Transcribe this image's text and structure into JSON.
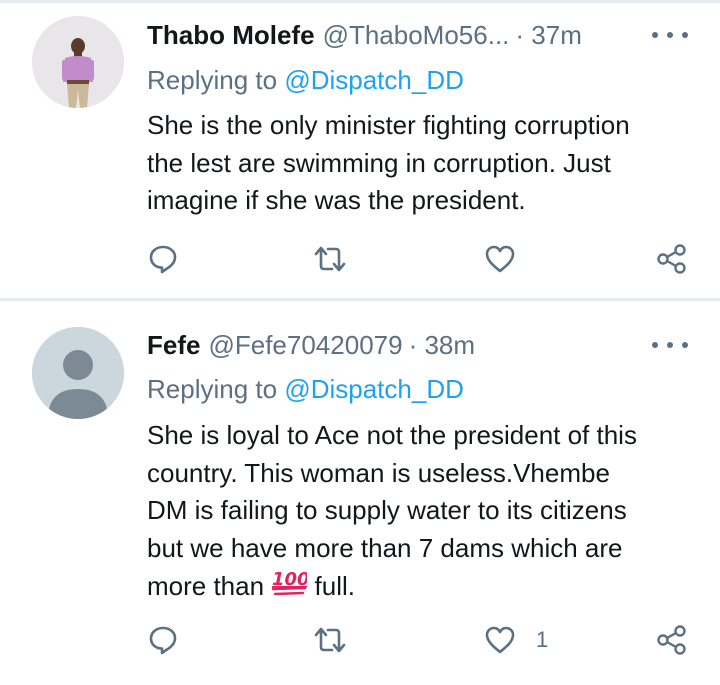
{
  "tweets": [
    {
      "name": "Thabo Molefe",
      "handle": "@ThaboMo56...",
      "time": "· 37m",
      "replying_prefix": "Replying to",
      "replying_to": "@Dispatch_DD",
      "text_lines": [
        "She is the only minister fighting corruption",
        "the lest are swimming in corruption. Just",
        "imagine if she was the president."
      ],
      "like_count": ""
    },
    {
      "name": "Fefe",
      "handle": "@Fefe70420079",
      "time": "· 38m",
      "replying_prefix": "Replying to",
      "replying_to": "@Dispatch_DD",
      "text_lines": [
        "She is loyal to Ace not the president of this",
        "country. This woman is useless.Vhembe",
        "DM is failing to supply water to its citizens",
        "but we have more than 7 dams which are"
      ],
      "text_last_before": "more than ",
      "text_last_emoji": "hundred-points-emoji",
      "text_last_after": " full.",
      "like_count": "1"
    }
  ],
  "icons": {
    "reply": "reply-icon",
    "retweet": "retweet-icon",
    "like": "heart-icon",
    "share": "share-icon",
    "more": "more-icon"
  },
  "colors": {
    "text": "#14171a",
    "muted": "#5b7083",
    "link": "#1da1f2",
    "divider": "#e6ecf0",
    "emoji": "#e0245e"
  }
}
